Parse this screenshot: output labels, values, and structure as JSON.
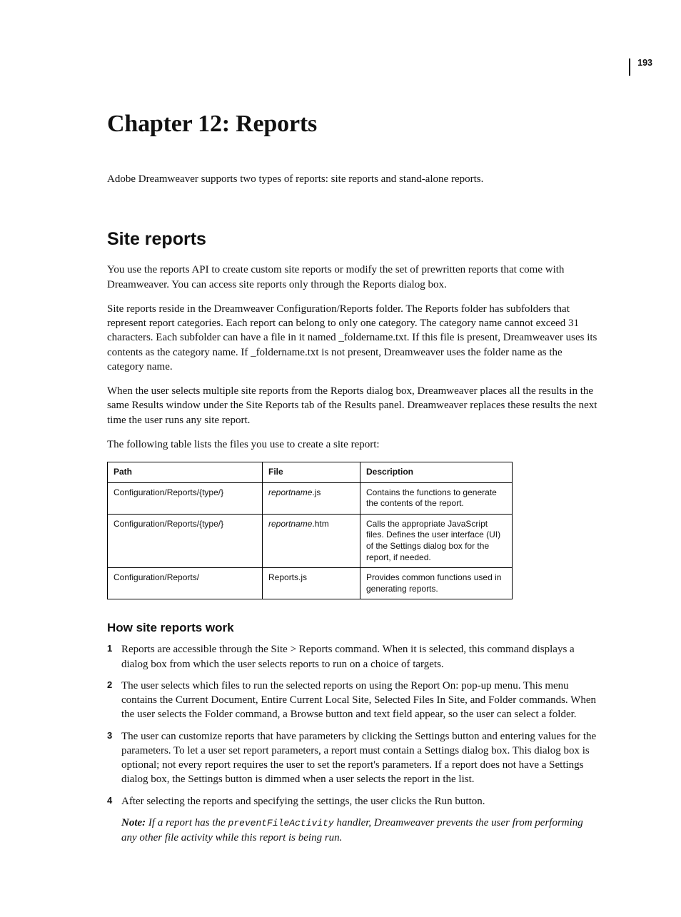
{
  "pageNumber": "193",
  "chapterTitle": "Chapter 12: Reports",
  "intro": "Adobe Dreamweaver supports two types of reports: site reports and stand-alone reports.",
  "sectionTitle": "Site reports",
  "para1": "You use the reports API to create custom site reports or modify the set of prewritten reports that come with Dreamweaver. You can access site reports only through the Reports dialog box.",
  "para2": "Site reports reside in the Dreamweaver Configuration/Reports folder. The Reports folder has subfolders that represent report categories. Each report can belong to only one category. The category name cannot exceed 31 characters. Each subfolder can have a file in it named _foldername.txt. If this file is present, Dreamweaver uses its contents as the category name. If _foldername.txt is not present, Dreamweaver uses the folder name as the category name.",
  "para3": "When the user selects multiple site reports from the Reports dialog box, Dreamweaver places all the results in the same Results window under the Site Reports tab of the Results panel. Dreamweaver replaces these results the next time the user runs any site report.",
  "para4": "The following table lists the files you use to create a site report:",
  "table": {
    "headers": {
      "path": "Path",
      "file": "File",
      "desc": "Description"
    },
    "rows": [
      {
        "path": "Configuration/Reports/{type/}",
        "fileItalic": "reportname",
        "fileExt": ".js",
        "desc": "Contains the functions to generate the contents of the report."
      },
      {
        "path": "Configuration/Reports/{type/}",
        "fileItalic": "reportname",
        "fileExt": ".htm",
        "desc": "Calls the appropriate JavaScript files. Defines the user interface (UI) of the Settings dialog box for the report, if needed."
      },
      {
        "path": "Configuration/Reports/",
        "fileItalic": "",
        "fileExt": "Reports.js",
        "desc": "Provides common functions used in generating reports."
      }
    ]
  },
  "subTitle": "How site reports work",
  "steps": [
    "Reports are accessible through the Site > Reports command. When it is selected, this command displays a dialog box from which the user selects reports to run on a choice of targets.",
    "The user selects which files to run the selected reports on using the Report On: pop-up menu. This menu contains the Current Document, Entire Current Local Site, Selected Files In Site, and Folder commands. When the user selects the Folder command, a Browse button and text field appear, so the user can select a folder.",
    "The user can customize reports that have parameters by clicking the Settings button and entering values for the parameters. To let a user set report parameters, a report must contain a Settings dialog box. This dialog box is optional; not every report requires the user to set the report's parameters. If a report does not have a Settings dialog box, the Settings button is dimmed when a user selects the report in the list.",
    "After selecting the reports and specifying the settings, the user clicks the Run button."
  ],
  "note": {
    "label": "Note:",
    "pre": " If a report has the ",
    "code": "preventFileActivity",
    "post": " handler, Dreamweaver prevents the user from performing any other file activity while this report is being run."
  }
}
